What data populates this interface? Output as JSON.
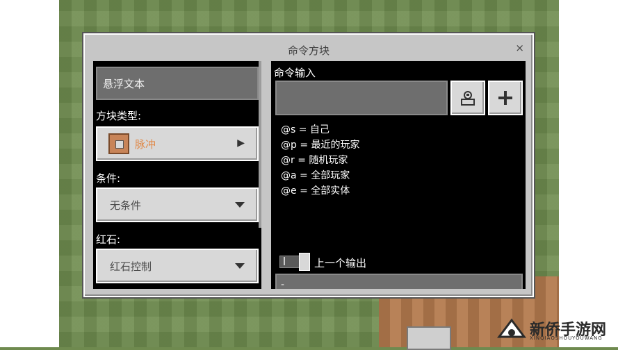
{
  "dialog": {
    "title": "命令方块",
    "close": "×"
  },
  "left": {
    "hover_text": "悬浮文本",
    "block_type_label": "方块类型:",
    "block_type_value": "脉冲",
    "condition_label": "条件:",
    "condition_value": "无条件",
    "redstone_label": "红石:",
    "redstone_value": "红石控制"
  },
  "right": {
    "command_input_label": "命令输入",
    "command_input_value": "",
    "hints": [
      "@s = 自己",
      "@p = 最近的玩家",
      "@r = 随机玩家",
      "@a = 全部玩家",
      "@e = 全部实体"
    ],
    "previous_output_label": "上一个输出",
    "output_text": "-"
  },
  "watermark": {
    "name": "新侨手游网",
    "sub": "XINQIAOSHOUYOUWANG"
  }
}
